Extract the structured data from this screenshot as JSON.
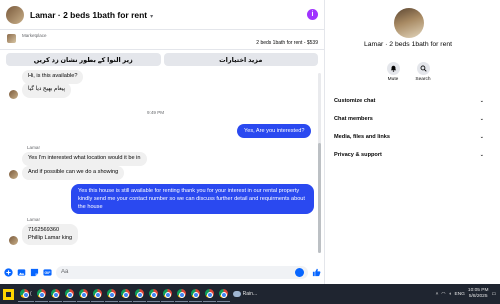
{
  "chat": {
    "title": "Lamar · 2 beds 1bath for rent",
    "listing_label": "Marketplace",
    "listing_price": "2 beds 1bath for rent - $539",
    "action_left": "زیر النوا کے بطور نشان زد کریں",
    "action_right": "مزید اختیارات",
    "messages": {
      "m1": "Hi, is this available?",
      "m2": "پیغام بھیج دیا گیا",
      "time": "9:49 PM",
      "m3": "Yes, Are you interested?",
      "sender1": "Lamar",
      "m4": "Yes I'm interested what location would it be in",
      "m5": "And if possible can we do a showing",
      "m6": "Yes this house is still available for renting thank you for your interest in our rental property kindly send me your contact number so we can discuss further detail and requirments about the house",
      "sender2": "Lamar",
      "m7_line1": "7162569360",
      "m7_line2": "Phillip Lamar king"
    },
    "composer_placeholder": "Aa"
  },
  "panel": {
    "name": "Lamar · 2 beds 1bath for rent",
    "mute_label": "Mute",
    "search_label": "Search",
    "rows": [
      {
        "label": "Customize chat"
      },
      {
        "label": "Chat members"
      },
      {
        "label": "Media, files and links"
      },
      {
        "label": "Privacy & support"
      }
    ]
  },
  "taskbar": {
    "weather": "Rain...",
    "lang": "ENG",
    "time": "10:05 PM",
    "date": "5/8/2025"
  },
  "colors": {
    "accent": "#0866ff",
    "outgoing_bubble": "#2a49f0",
    "incoming_bubble": "#f0f0f0",
    "info_icon": "#a033ff"
  }
}
